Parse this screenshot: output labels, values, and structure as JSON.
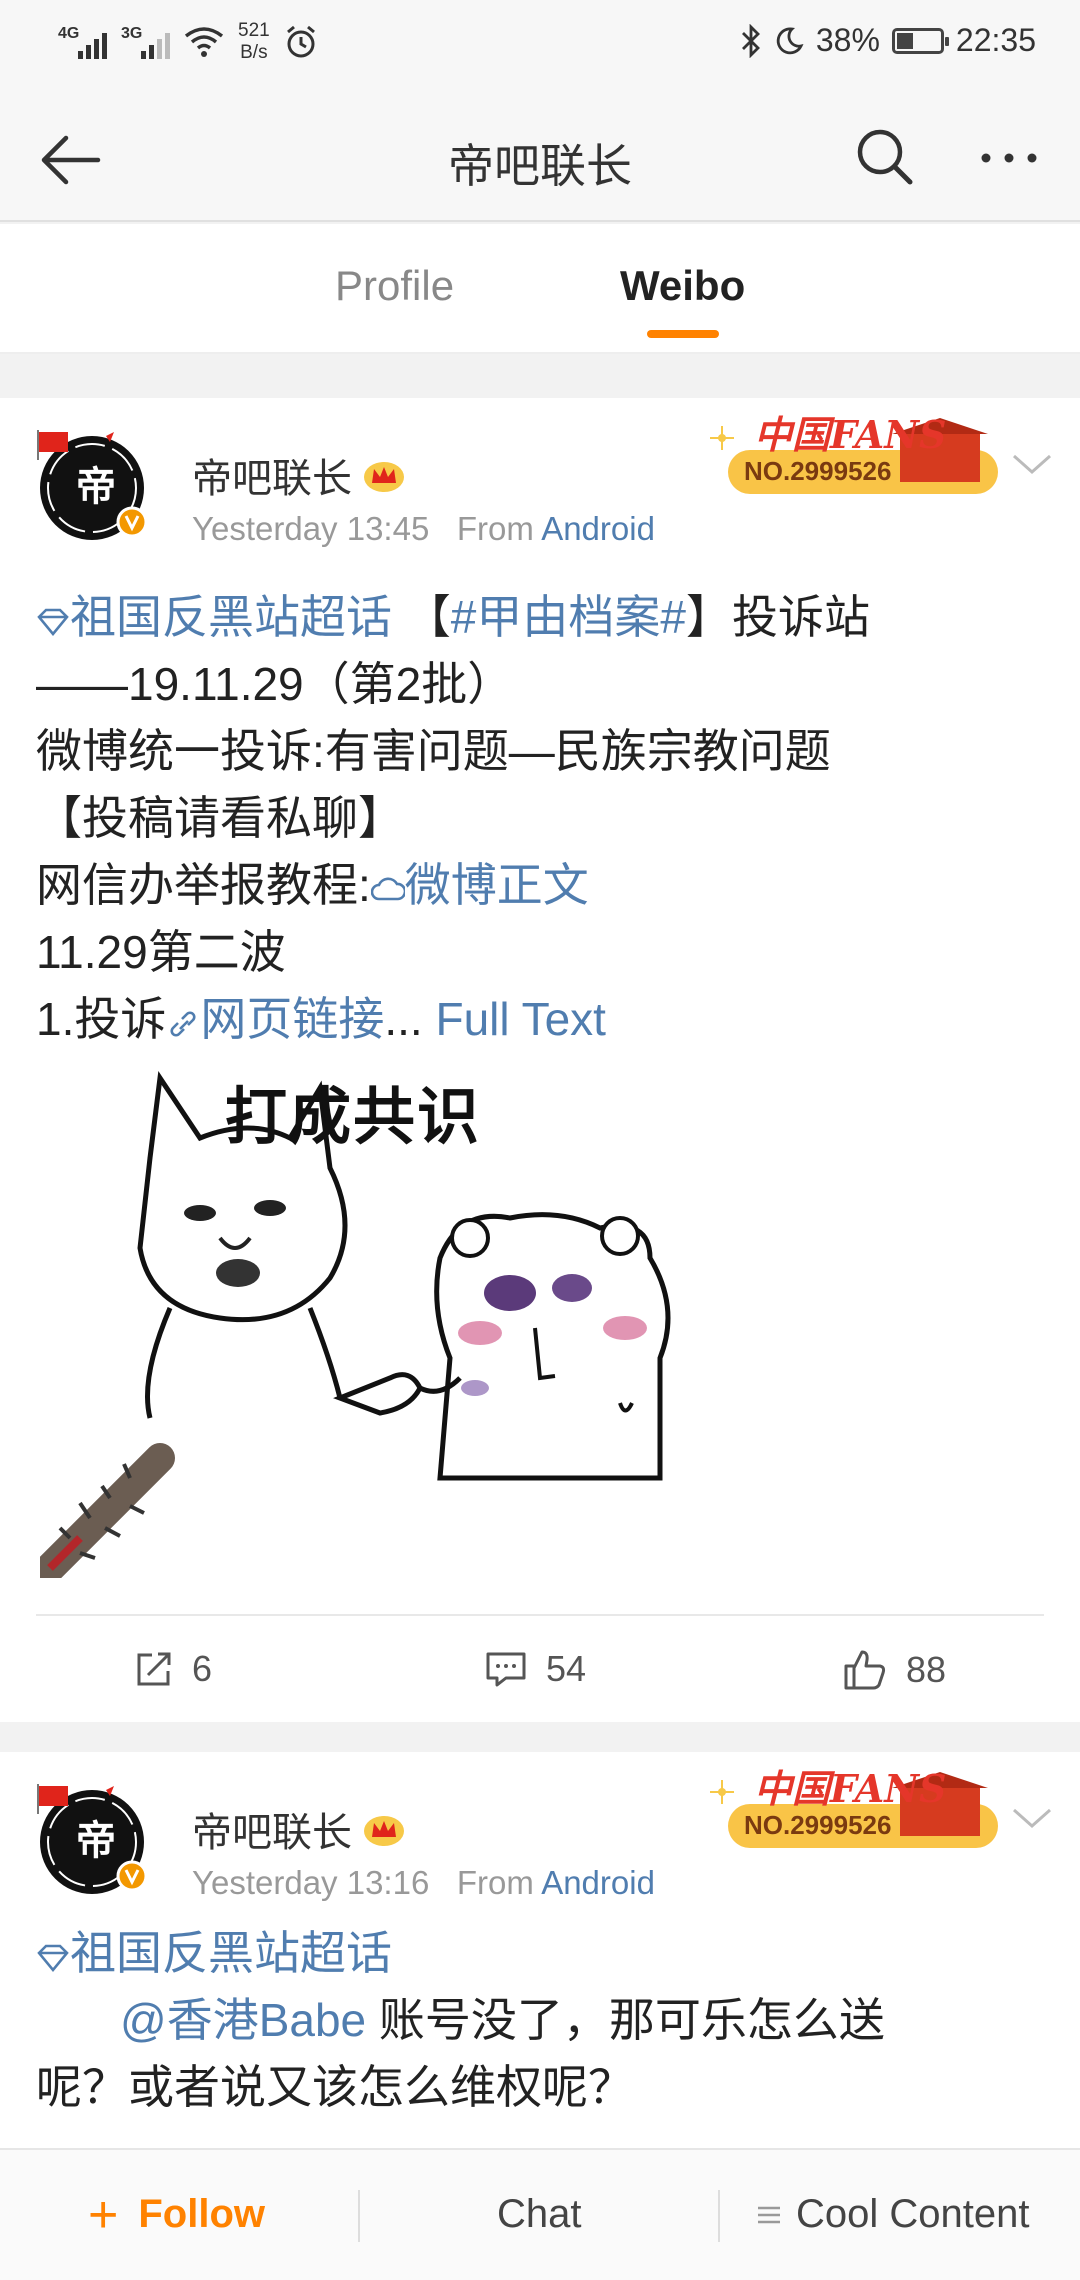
{
  "status_bar": {
    "network_1": "4G",
    "network_2": "3G",
    "speed_value": "521",
    "speed_unit": "B/s",
    "battery": "38%",
    "battery_level": 0.38,
    "time": "22:35"
  },
  "nav": {
    "title": "帝吧联长",
    "back_icon": "arrow-left-icon",
    "search_icon": "search-icon",
    "more_icon": "more-icon"
  },
  "tabs": [
    {
      "label": "Profile",
      "active": false
    },
    {
      "label": "Weibo",
      "active": true
    }
  ],
  "posts": [
    {
      "user": "帝吧联长",
      "time": "Yesterday 13:45",
      "from_label": "From",
      "source": "Android",
      "fans_badge": {
        "title": "中国FANS",
        "number": "NO.2999526"
      },
      "topic": "祖国反黑站超话",
      "line1_mid": " 【",
      "hashtag": "#甲由档案#",
      "line1_end": "】投诉站",
      "line2": "——19.11.29（第2批）",
      "line3": "微博统一投诉:有害问题—民族宗教问题",
      "line4": "【投稿请看私聊】",
      "line5_prefix": "网信办举报教程:",
      "line5_link": "微博正文",
      "line6": "11.29第二波",
      "line7_prefix": "1.投诉",
      "line7_link": "网页链接",
      "ellipsis": "...",
      "full_text": "Full Text",
      "image_caption": "打成共识",
      "reposts": "6",
      "comments": "54",
      "likes": "88"
    },
    {
      "user": "帝吧联长",
      "time": "Yesterday 13:16",
      "from_label": "From",
      "source": "Android",
      "fans_badge": {
        "title": "中国FANS",
        "number": "NO.2999526"
      },
      "topic": "祖国反黑站超话",
      "mention": "@香港Babe",
      "line2_rest": " 账号没了，那可乐怎么送",
      "line3": "呢？或者说又该怎么维权呢？"
    }
  ],
  "bottom_bar": {
    "follow": "Follow",
    "chat": "Chat",
    "cool": "Cool Content"
  },
  "colors": {
    "accent": "#ff8200",
    "link": "#507daf"
  }
}
